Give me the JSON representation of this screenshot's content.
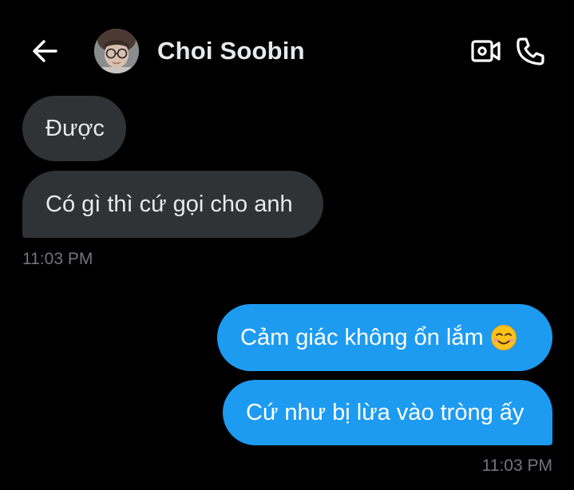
{
  "header": {
    "back_icon": "arrow-left-icon",
    "contact_name": "Choi Soobin",
    "video_icon": "video-camera-icon",
    "call_icon": "phone-icon"
  },
  "messages": [
    {
      "direction": "incoming",
      "text": "Được"
    },
    {
      "direction": "incoming",
      "text": "Có gì thì cứ gọi cho anh"
    },
    {
      "direction": "outgoing",
      "text": "Cảm giác không ổn lắm",
      "emoji": "smiling-face-icon"
    },
    {
      "direction": "outgoing",
      "text": "Cứ như bị lừa vào tròng ấy"
    }
  ],
  "timestamps": {
    "incoming": "11:03 PM",
    "outgoing": "11:03 PM"
  },
  "colors": {
    "background": "#000000",
    "incoming_bubble": "#2f3336",
    "outgoing_bubble": "#1d9bf0",
    "primary_text": "#e7e9ea",
    "secondary_text": "#71767b"
  }
}
